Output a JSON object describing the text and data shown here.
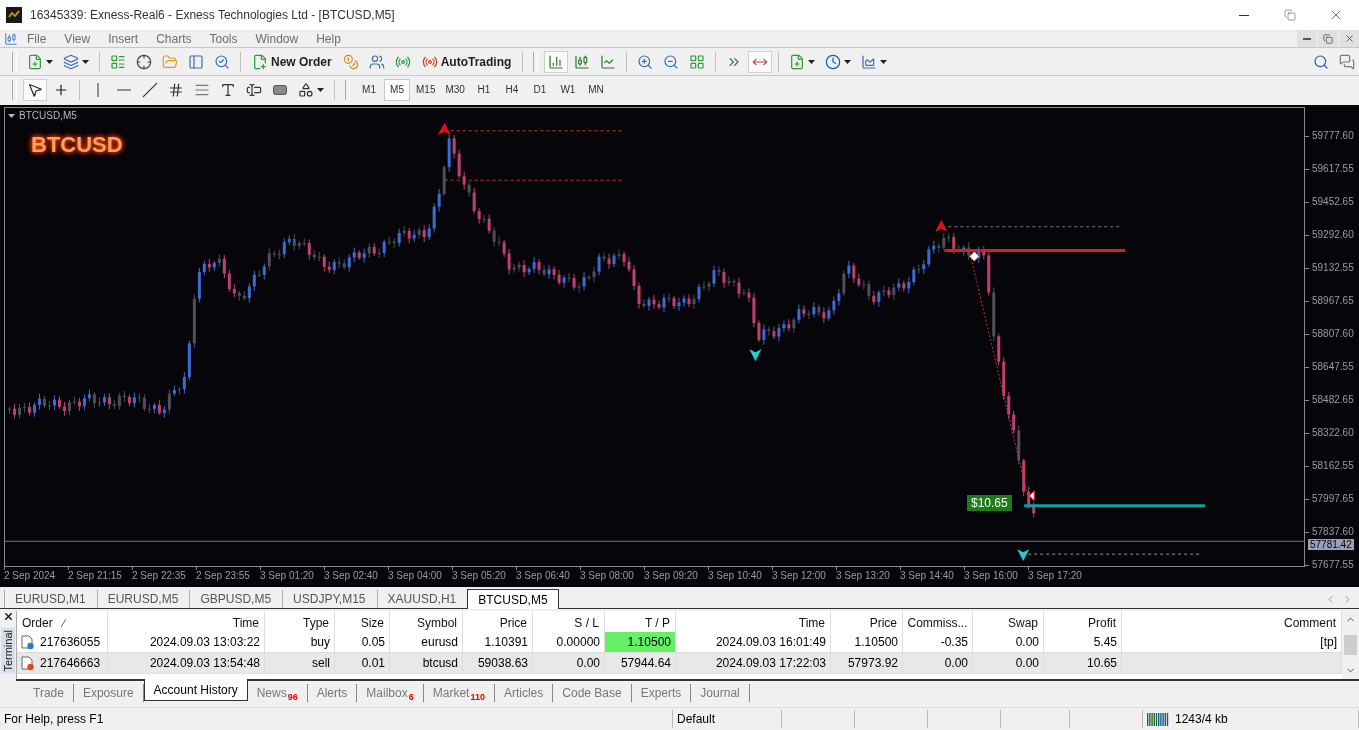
{
  "window": {
    "title": "16345339: Exness-Real6 - Exness Technologies Ltd - [BTCUSD,M5]"
  },
  "menu": [
    "File",
    "View",
    "Insert",
    "Charts",
    "Tools",
    "Window",
    "Help"
  ],
  "toolbar": {
    "new_order": "New Order",
    "auto_trading": "AutoTrading"
  },
  "timeframes": [
    {
      "label": "M1",
      "selected": false
    },
    {
      "label": "M5",
      "selected": true
    },
    {
      "label": "M15",
      "selected": false
    },
    {
      "label": "M30",
      "selected": false
    },
    {
      "label": "H1",
      "selected": false
    },
    {
      "label": "H4",
      "selected": false
    },
    {
      "label": "D1",
      "selected": false
    },
    {
      "label": "W1",
      "selected": false
    },
    {
      "label": "MN",
      "selected": false
    }
  ],
  "chart": {
    "caption": "BTCUSD,M5",
    "symbol_label": "BTCUSD",
    "profit_label": "$10.65",
    "current_price": "57781.42",
    "price_axis": [
      "59777.60",
      "59617.55",
      "59452.65",
      "59292.60",
      "59132.55",
      "58967.65",
      "58807.60",
      "58647.55",
      "58482.65",
      "58322.60",
      "58162.55",
      "57997.65",
      "57837.60",
      "57677.55"
    ],
    "time_axis": [
      "2 Sep 2024",
      "2 Sep 21:15",
      "2 Sep 22:35",
      "2 Sep 23:55",
      "3 Sep 01:20",
      "3 Sep 02:40",
      "3 Sep 04:00",
      "3 Sep 05:20",
      "3 Sep 06:40",
      "3 Sep 08:00",
      "3 Sep 09:20",
      "3 Sep 10:40",
      "3 Sep 12:00",
      "3 Sep 13:20",
      "3 Sep 14:40",
      "3 Sep 16:00",
      "3 Sep 17:20"
    ]
  },
  "chart_tabs": [
    {
      "label": "EURUSD,M1",
      "selected": false
    },
    {
      "label": "EURUSD,M5",
      "selected": false
    },
    {
      "label": "GBPUSD,M5",
      "selected": false
    },
    {
      "label": "USDJPY,M15",
      "selected": false
    },
    {
      "label": "XAUUSD,H1",
      "selected": false
    },
    {
      "label": "BTCUSD,M5",
      "selected": true
    }
  ],
  "terminal": {
    "side_label": "Terminal",
    "columns": [
      "Order",
      "Time",
      "Type",
      "Size",
      "Symbol",
      "Price",
      "S / L",
      "T / P",
      "Time",
      "Price",
      "Commiss...",
      "Swap",
      "Profit",
      "Comment"
    ],
    "rows": [
      {
        "kind": "buy",
        "tp_hit": true,
        "cells": [
          "217636055",
          "2024.09.03 13:03:22",
          "buy",
          "0.05",
          "eurusd",
          "1.10391",
          "0.00000",
          "1.10500",
          "2024.09.03 16:01:49",
          "1.10500",
          "-0.35",
          "0.00",
          "5.45",
          "[tp]"
        ]
      },
      {
        "kind": "sell",
        "tp_hit": false,
        "cells": [
          "217646663",
          "2024.09.03 13:54:48",
          "sell",
          "0.01",
          "btcusd",
          "59038.63",
          "0.00",
          "57944.64",
          "2024.09.03 17:22:03",
          "57973.92",
          "0.00",
          "0.00",
          "10.65"
        ]
      }
    ],
    "tabs": [
      {
        "label": "Trade",
        "selected": false
      },
      {
        "label": "Exposure",
        "selected": false
      },
      {
        "label": "Account History",
        "selected": true
      },
      {
        "label": "News",
        "badge": "96",
        "selected": false
      },
      {
        "label": "Alerts",
        "selected": false
      },
      {
        "label": "Mailbox",
        "badge": "6",
        "selected": false
      },
      {
        "label": "Market",
        "badge": "110",
        "selected": false
      },
      {
        "label": "Articles",
        "selected": false
      },
      {
        "label": "Code Base",
        "selected": false
      },
      {
        "label": "Experts",
        "selected": false
      },
      {
        "label": "Journal",
        "selected": false
      }
    ]
  },
  "status_bar": {
    "help": "For Help, press F1",
    "profile": "Default",
    "traffic": "1243/4 kb"
  }
}
